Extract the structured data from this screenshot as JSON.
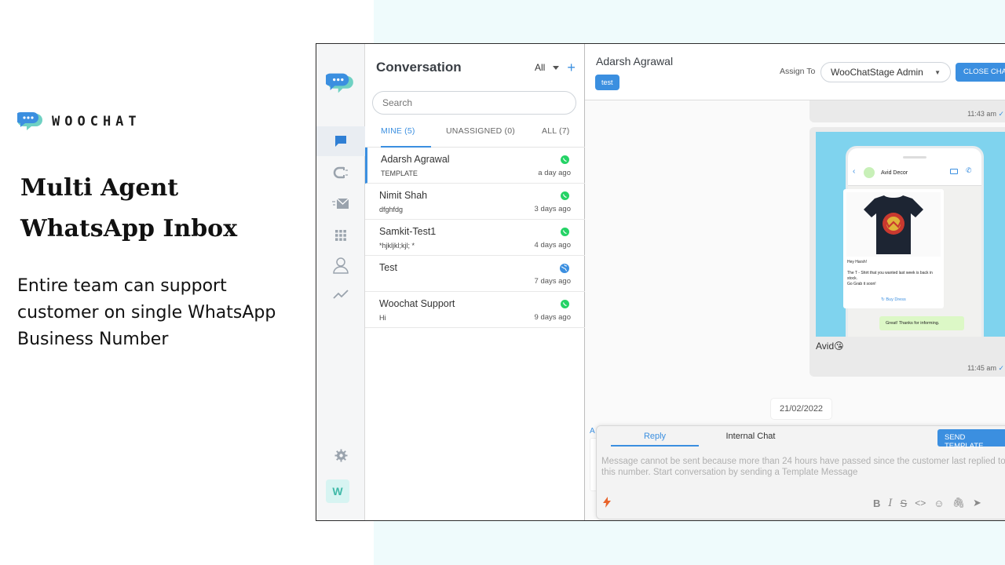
{
  "promo": {
    "brand_name": "WOOCHAT",
    "headline_line1": "Multi Agent",
    "headline_line2": "WhatsApp Inbox",
    "subtext": "Entire team can support customer on single WhatsApp Business Number"
  },
  "sidebar": {
    "icons": [
      "chat-bubble-icon",
      "magnet-icon",
      "mail-icon",
      "grid-icon",
      "user-icon",
      "trend-icon",
      "gear-icon"
    ],
    "avatar_letter": "W"
  },
  "conversations": {
    "title": "Conversation",
    "filter_value": "All",
    "search_placeholder": "Search",
    "tabs": [
      {
        "label": "MINE (5)",
        "active": true
      },
      {
        "label": "UNASSIGNED (0)",
        "active": false
      },
      {
        "label": "ALL (7)",
        "active": false
      }
    ],
    "rows": [
      {
        "name": "Adarsh Agrawal",
        "preview": "TEMPLATE",
        "time": "a day ago",
        "channel": "whatsapp"
      },
      {
        "name": "Nimit Shah",
        "preview": "dfghfdg",
        "time": "3 days ago",
        "channel": "whatsapp"
      },
      {
        "name": "Samkit-Test1",
        "preview": "*hjkljkl;kjl; *",
        "time": "4 days ago",
        "channel": "whatsapp"
      },
      {
        "name": "Test",
        "preview": "",
        "time": "7 days ago",
        "channel": "web"
      },
      {
        "name": "Woochat Support",
        "preview": "Hi",
        "time": "9 days ago",
        "channel": "whatsapp"
      }
    ]
  },
  "chat": {
    "contact_name": "Adarsh Agrawal",
    "tag": "test",
    "assign_label": "Assign To",
    "assignee": "WooChatStage Admin",
    "close_label": "CLOSE CHAT",
    "messages": [
      {
        "time": "11:43 am"
      },
      {
        "image": {
          "store_name": "Avid Decor",
          "greeting": "Hey Harsh!",
          "body_line1": "The T - Shirt that you wanted last week is back in stock.",
          "body_line2": "Go Grab it soon!",
          "link": "Buy Dress",
          "reply": "Great! Thanks for informing."
        },
        "caption": "Avid😘",
        "time": "11:45 am"
      }
    ],
    "date_separator": "21/02/2022",
    "composer": {
      "tab_reply": "Reply",
      "tab_internal": "Internal Chat",
      "send_template": "SEND TEMPLATE",
      "placeholder": "Message cannot be sent because more than 24 hours have passed since the customer last replied to this number. Start conversation by sending a Template Message"
    },
    "side_letter": "A"
  },
  "colors": {
    "accent": "#3b8fe0",
    "whatsapp": "#25d366",
    "background_tint": "#effbfc",
    "brand_teal": "#3fb9a8"
  }
}
